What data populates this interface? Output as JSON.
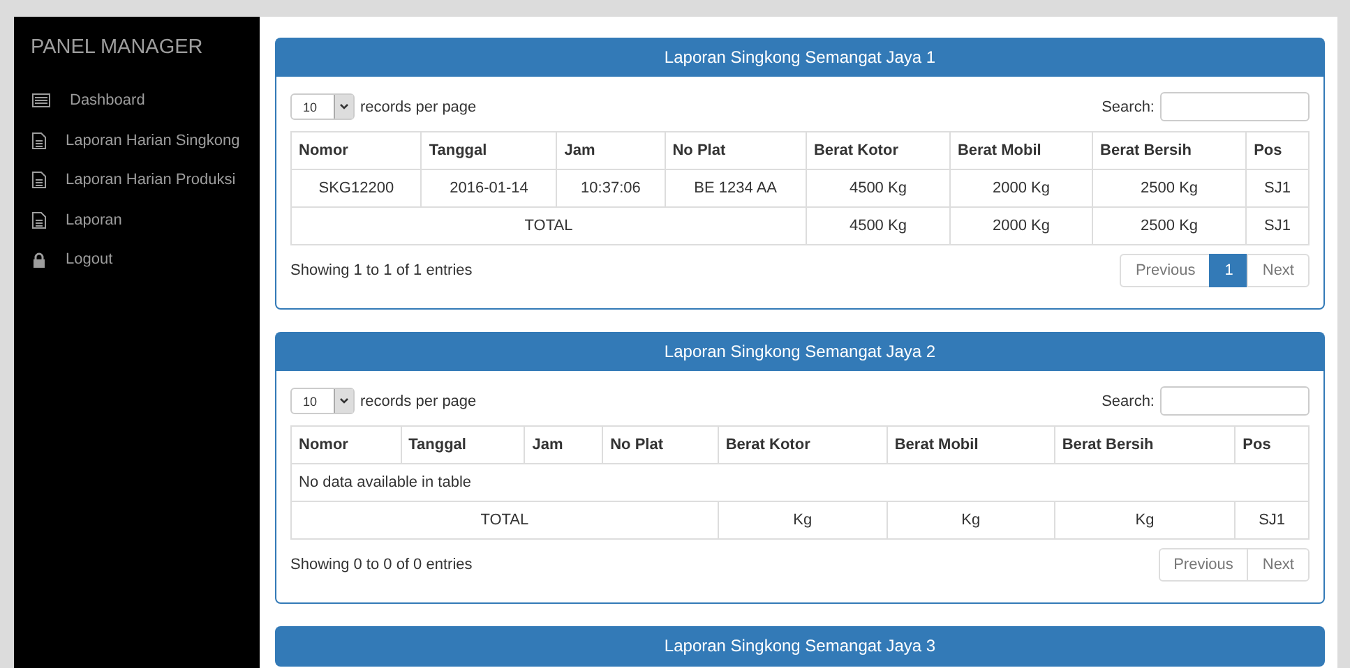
{
  "sidebar": {
    "title": "PANEL MANAGER",
    "items": [
      {
        "label": "Dashboard",
        "kind": "list"
      },
      {
        "label": "Laporan Harian Singkong",
        "kind": "file"
      },
      {
        "label": "Laporan Harian Produksi",
        "kind": "file"
      },
      {
        "label": "Laporan",
        "kind": "file"
      },
      {
        "label": "Logout",
        "kind": "lock"
      }
    ]
  },
  "panels": [
    {
      "title": "Laporan Singkong Semangat Jaya 1",
      "length": "10",
      "length_label": "records per page",
      "search_label": "Search:",
      "columns": [
        "Nomor",
        "Tanggal",
        "Jam",
        "No Plat",
        "Berat Kotor",
        "Berat Mobil",
        "Berat Bersih",
        "Pos"
      ],
      "rows": [
        {
          "kind": "data",
          "cells": [
            "SKG12200",
            "2016-01-14",
            "10:37:06",
            "BE 1234 AA",
            "4500 Kg",
            "2000 Kg",
            "2500 Kg",
            "SJ1"
          ]
        },
        {
          "kind": "total",
          "cells": [
            {
              "text": "TOTAL",
              "colspan": 4
            },
            {
              "text": "4500 Kg"
            },
            {
              "text": "2000 Kg"
            },
            {
              "text": "2500 Kg"
            },
            {
              "text": "SJ1"
            }
          ]
        }
      ],
      "info": "Showing 1 to 1 of 1 entries",
      "pages": [
        {
          "label": "Previous",
          "selected": false,
          "disabled": true
        },
        {
          "label": "1",
          "selected": true,
          "disabled": false
        },
        {
          "label": "Next",
          "selected": false,
          "disabled": true
        }
      ]
    },
    {
      "title": "Laporan Singkong Semangat Jaya 2",
      "length": "10",
      "length_label": "records per page",
      "search_label": "Search:",
      "columns": [
        "Nomor",
        "Tanggal",
        "Jam",
        "No Plat",
        "Berat Kotor",
        "Berat Mobil",
        "Berat Bersih",
        "Pos"
      ],
      "rows": [
        {
          "kind": "empty",
          "label": "No data available in table"
        },
        {
          "kind": "total",
          "cells": [
            {
              "text": "TOTAL",
              "colspan": 4
            },
            {
              "text": "Kg"
            },
            {
              "text": "Kg"
            },
            {
              "text": "Kg"
            },
            {
              "text": "SJ1"
            }
          ]
        }
      ],
      "info": "Showing 0 to 0 of 0 entries",
      "pages": [
        {
          "label": "Previous",
          "selected": false,
          "disabled": true
        },
        {
          "label": "Next",
          "selected": false,
          "disabled": true
        }
      ]
    },
    {
      "title": "Laporan Singkong Semangat Jaya 3"
    }
  ]
}
